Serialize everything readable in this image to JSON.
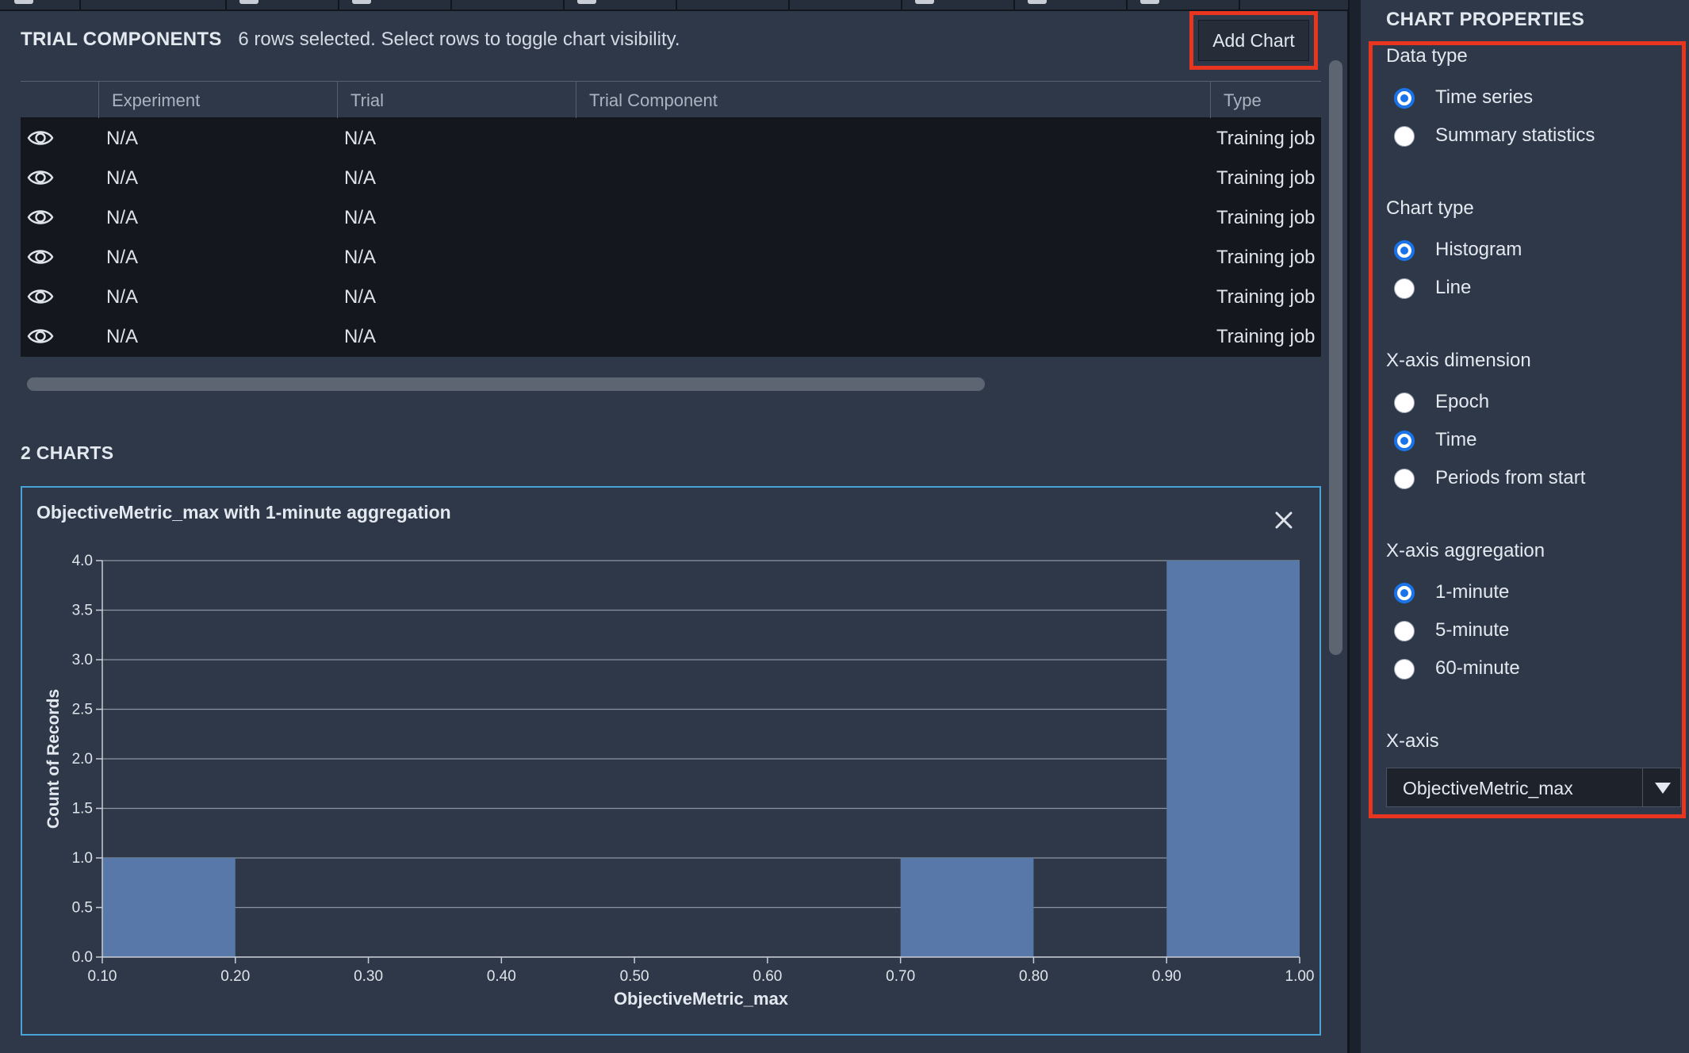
{
  "trial_components": {
    "title": "TRIAL COMPONENTS",
    "selection_info": "6 rows selected. Select rows to toggle chart visibility.",
    "add_chart_label": "Add Chart",
    "columns": [
      "Experiment",
      "Trial",
      "Trial Component",
      "Type"
    ],
    "rows": [
      {
        "experiment": "N/A",
        "trial": "N/A",
        "trial_component": "",
        "type": "Training job"
      },
      {
        "experiment": "N/A",
        "trial": "N/A",
        "trial_component": "",
        "type": "Training job"
      },
      {
        "experiment": "N/A",
        "trial": "N/A",
        "trial_component": "",
        "type": "Training job"
      },
      {
        "experiment": "N/A",
        "trial": "N/A",
        "trial_component": "",
        "type": "Training job"
      },
      {
        "experiment": "N/A",
        "trial": "N/A",
        "trial_component": "",
        "type": "Training job"
      },
      {
        "experiment": "N/A",
        "trial": "N/A",
        "trial_component": "",
        "type": "Training job"
      }
    ]
  },
  "charts": {
    "title": "2 CHARTS",
    "card_title": "ObjectiveMetric_max with 1-minute aggregation"
  },
  "chart_data": {
    "type": "bar",
    "bins": [
      {
        "start": 0.1,
        "end": 0.2,
        "count": 1
      },
      {
        "start": 0.7,
        "end": 0.8,
        "count": 1
      },
      {
        "start": 0.9,
        "end": 1.0,
        "count": 4
      }
    ],
    "xlim": [
      0.1,
      1.0
    ],
    "ylim": [
      0.0,
      4.0
    ],
    "x_ticks": [
      "0.10",
      "0.20",
      "0.30",
      "0.40",
      "0.50",
      "0.60",
      "0.70",
      "0.80",
      "0.90",
      "1.00"
    ],
    "y_ticks": [
      "0.0",
      "0.5",
      "1.0",
      "1.5",
      "2.0",
      "2.5",
      "3.0",
      "3.5",
      "4.0"
    ],
    "xlabel": "ObjectiveMetric_max",
    "ylabel": "Count of Records",
    "grid": true,
    "bar_color": "#5778a8"
  },
  "chart_properties": {
    "title": "CHART PROPERTIES",
    "data_type": {
      "label": "Data type",
      "options": [
        "Time series",
        "Summary statistics"
      ],
      "selected": "Time series"
    },
    "chart_type": {
      "label": "Chart type",
      "options": [
        "Histogram",
        "Line"
      ],
      "selected": "Histogram"
    },
    "x_axis_dimension": {
      "label": "X-axis dimension",
      "options": [
        "Epoch",
        "Time",
        "Periods from start"
      ],
      "selected": "Time"
    },
    "x_axis_aggregation": {
      "label": "X-axis aggregation",
      "options": [
        "1-minute",
        "5-minute",
        "60-minute"
      ],
      "selected": "1-minute"
    },
    "x_axis": {
      "label": "X-axis",
      "value": "ObjectiveMetric_max"
    }
  },
  "colors": {
    "accent": "#1a73e8",
    "highlight": "#e8351f",
    "chart_border": "#4aa3d6"
  }
}
